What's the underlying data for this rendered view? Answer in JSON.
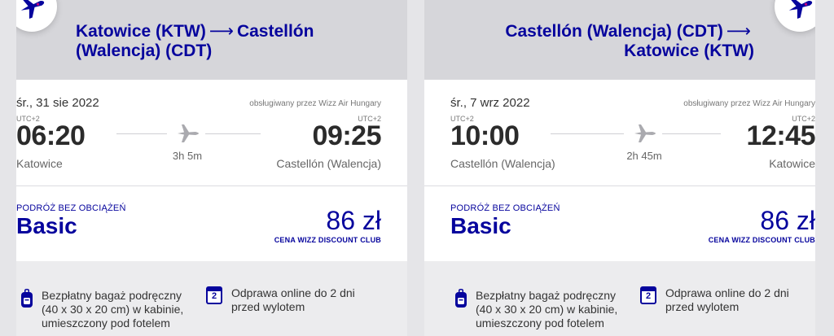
{
  "colors": {
    "brand": "#06049d",
    "accent": "#c6007e"
  },
  "icons": {
    "plane_badge": "plane-icon",
    "plane_mid": "plane-icon",
    "luggage": "backpack-icon",
    "checkin": "calendar-icon"
  },
  "panels": [
    {
      "route_from": "Katowice (KTW)",
      "route_arrow": "⟶",
      "route_to": "Castellón (Walencja) (CDT)",
      "date": "śr., 31 sie 2022",
      "operator": "obsługiwany przez Wizz Air Hungary",
      "dep_tz": "UTC+2",
      "dep_time": "06:20",
      "dep_city": "Katowice",
      "duration": "3h 5m",
      "arr_tz": "UTC+2",
      "arr_time": "09:25",
      "arr_city": "Castellón (Walencja)",
      "fare_sub": "PODRÓŻ BEZ OBCIĄŻEŃ",
      "fare_name": "Basic",
      "price": "86 zł",
      "club": "CENA WIZZ DISCOUNT CLUB",
      "perk_bag": [
        "Bezpłatny bagaż podręczny",
        "(40 x 30 x 20 cm) w kabinie,",
        "umieszczony pod fotelem"
      ],
      "perk_checkin": [
        "Odprawa online do 2 dni",
        "przed wylotem"
      ],
      "checkin_days": "2"
    },
    {
      "route_from": "Castellón (Walencja) (CDT)",
      "route_arrow": "⟶",
      "route_to": "Katowice (KTW)",
      "date": "śr., 7 wrz 2022",
      "operator": "obsługiwany przez Wizz Air Hungary",
      "dep_tz": "UTC+2",
      "dep_time": "10:00",
      "dep_city": "Castellón (Walencja)",
      "duration": "2h 45m",
      "arr_tz": "UTC+2",
      "arr_time": "12:45",
      "arr_city": "Katowice",
      "fare_sub": "PODRÓŻ BEZ OBCIĄŻEŃ",
      "fare_name": "Basic",
      "price": "86 zł",
      "club": "CENA WIZZ DISCOUNT CLUB",
      "perk_bag": [
        "Bezpłatny bagaż podręczny",
        "(40 x 30 x 20 cm) w kabinie,",
        "umieszczony pod fotelem"
      ],
      "perk_checkin": [
        "Odprawa online do 2 dni",
        "przed wylotem"
      ],
      "checkin_days": "2"
    }
  ]
}
